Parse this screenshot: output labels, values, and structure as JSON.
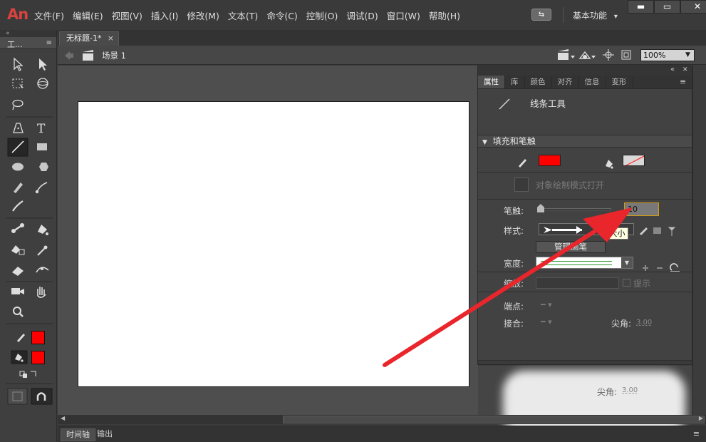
{
  "app": {
    "logo": "An"
  },
  "menu": [
    "文件(F)",
    "编辑(E)",
    "视图(V)",
    "插入(I)",
    "修改(M)",
    "文本(T)",
    "命令(C)",
    "控制(O)",
    "调试(D)",
    "窗口(W)",
    "帮助(H)"
  ],
  "titlebar": {
    "workspace": "基本功能",
    "workspace_arrow": "▾",
    "sync_icon": "sync-settings-icon",
    "minimize": "▬",
    "maximize": "▭",
    "close": "✕"
  },
  "tools_panel": {
    "title": "工...",
    "menu_icon": "panel-menu-icon",
    "stroke_color": "#ff0000",
    "fill_color": "#ff0000"
  },
  "document": {
    "tab_label": "无标题-1*",
    "tab_close": "×",
    "scene_label": "场景 1",
    "zoom": "100%"
  },
  "properties": {
    "header_close": "✕",
    "header_collapse": "«",
    "tabs": [
      "属性",
      "库",
      "颜色",
      "对齐",
      "信息",
      "变形"
    ],
    "active_tab": "属性",
    "tool_name": "线条工具",
    "section_fill_stroke": "填充和笔触",
    "stroke_color": "#ff0000",
    "object_draw_mode": "对象绘制模式打开",
    "stroke_label": "笔触:",
    "stroke_value": "10",
    "tooltip": "大小",
    "style_label": "样式:",
    "manage_button": "管理画笔",
    "width_label": "宽度:",
    "scale_label": "缩放:",
    "hint_label": "提示",
    "cap_label": "端点:",
    "join_label": "接合:",
    "miter_label": "尖角:",
    "miter_value": "3.00"
  },
  "ghost": {
    "miter_label": "尖角:",
    "miter_value": "3.00"
  },
  "bottom": {
    "timeline_tab": "时间轴",
    "output_tab": "输出"
  }
}
